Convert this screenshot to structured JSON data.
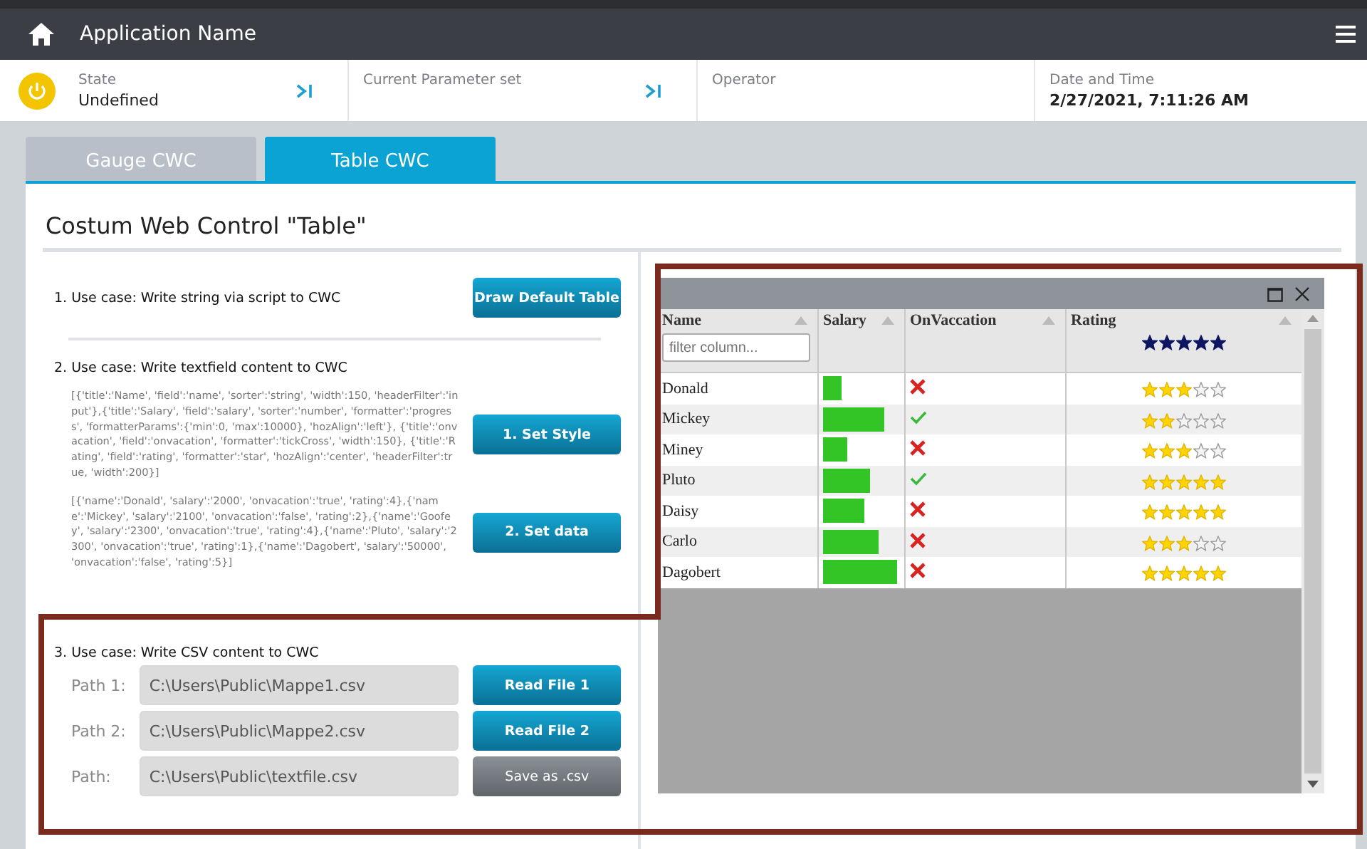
{
  "app": {
    "title": "Application Name"
  },
  "status": [
    {
      "kind": "state",
      "label": "State",
      "value": "Undefined"
    },
    {
      "kind": "parameter",
      "label": "Current Parameter set"
    },
    {
      "kind": "operator",
      "label": "Operator"
    },
    {
      "kind": "datetime",
      "label": "Date and Time",
      "value": "2/27/2021, 7:11:26 AM"
    }
  ],
  "tabs": [
    {
      "label": "Gauge CWC",
      "selected": false
    },
    {
      "label": "Table CWC",
      "selected": true
    }
  ],
  "panel": {
    "title": "Costum Web Control \"Table\""
  },
  "use_case_1": {
    "title": "1. Use case: Write string via script to CWC",
    "button": "Draw Default Table"
  },
  "use_case_2": {
    "title": "2. Use case: Write textfield content  to CWC",
    "blocks": [
      {
        "code": "[{'title':'Name', 'field':'name', 'sorter':'string', 'width':150, 'headerFilter':'input'},{'title':'Salary', 'field':'salary', 'sorter':'number', 'formatter':'progress', 'formatterParams':{'min':0, 'max':10000}, 'hozAlign':'left'}, {'title':'onvacation', 'field':'onvacation', 'formatter':'tickCross', 'width':150}, {'title':'Rating', 'field':'rating', 'formatter':'star', 'hozAlign':'center', 'headerFilter':true, 'width':200}]",
        "button": "1. Set Style"
      },
      {
        "code": "[{'name':'Donald', 'salary':'2000', 'onvacation':'true', 'rating':4},{'name':'Mickey', 'salary':'2100', 'onvacation':'false', 'rating':2},{'name':'Goofey', 'salary':'2300', 'onvacation':'true', 'rating':4},{'name':'Pluto', 'salary':'2300', 'onvacation':'true', 'rating':1},{'name':'Dagobert', 'salary':'50000', 'onvacation':'false', 'rating':5}]",
        "button": "2. Set data"
      }
    ]
  },
  "use_case_3": {
    "title": "3. Use case: Write CSV content to CWC",
    "files": [
      {
        "label": "Path 1:",
        "value": "C:\\Users\\Public\\Mappe1.csv",
        "button": "Read File 1",
        "kind": "primary"
      },
      {
        "label": "Path 2:",
        "value": "C:\\Users\\Public\\Mappe2.csv",
        "button": "Read File 2",
        "kind": "primary"
      },
      {
        "label": "Path:",
        "value": "C:\\Users\\Public\\textfile.csv",
        "button": "Save as .csv",
        "kind": "secondary"
      }
    ]
  },
  "table": {
    "columns": [
      {
        "kind": "text",
        "title": "Name",
        "placeholder": "filter column..."
      },
      {
        "kind": "progress",
        "title": "Salary"
      },
      {
        "kind": "tick",
        "title": "OnVaccation"
      },
      {
        "kind": "stars",
        "title": "Rating",
        "stars": 5
      }
    ],
    "rows": [
      {
        "name": "Donald",
        "level": 0.24,
        "on_vacation": false,
        "stars": 3
      },
      {
        "name": "Mickey",
        "level": 0.79,
        "on_vacation": true,
        "stars": 2
      },
      {
        "name": "Miney",
        "level": 0.31,
        "on_vacation": false,
        "stars": 3
      },
      {
        "name": "Pluto",
        "level": 0.61,
        "on_vacation": true,
        "stars": 5
      },
      {
        "name": "Daisy",
        "level": 0.53,
        "on_vacation": false,
        "stars": 5
      },
      {
        "name": "Carlo",
        "level": 0.73,
        "on_vacation": false,
        "stars": 3
      },
      {
        "name": "Dagobert",
        "level": 0.97,
        "on_vacation": false,
        "stars": 5
      }
    ]
  }
}
